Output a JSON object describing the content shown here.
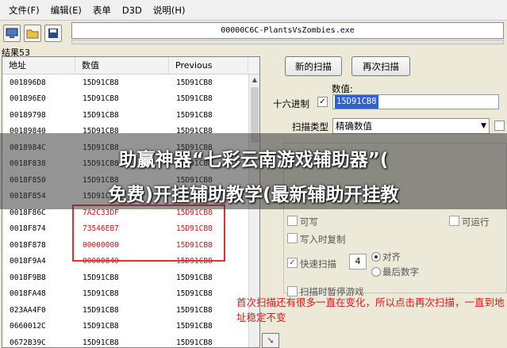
{
  "menu": [
    "文件(F)",
    "编辑(E)",
    "表单",
    "D3D",
    "说明(H)"
  ],
  "process": "00000C6C-PlantsVsZombies.exe",
  "result_count": "结果53",
  "list": {
    "headers": [
      "地址",
      "数值",
      "Previous"
    ],
    "rows": [
      {
        "addr": "001896D8",
        "val": "15D91CB8",
        "prev": "15D91CB8"
      },
      {
        "addr": "001896E0",
        "val": "15D91CB8",
        "prev": "15D91CB8"
      },
      {
        "addr": "00189798",
        "val": "15D91CB8",
        "prev": "15D91CB8"
      },
      {
        "addr": "00189840",
        "val": "15D91CB8",
        "prev": "15D91CB8"
      },
      {
        "addr": "0018984C",
        "val": "15D91CB8",
        "prev": "15D91CB8"
      },
      {
        "addr": "0018F838",
        "val": "15D91CB8",
        "prev": "15D91CB8"
      },
      {
        "addr": "0018F850",
        "val": "15D91CB8",
        "prev": "15D91CB8"
      },
      {
        "addr": "0018F854",
        "val": "15D91CB8",
        "prev": "15D91CB8"
      },
      {
        "addr": "0018F86C",
        "val": "7A2C33DF",
        "prev": "15D91CB8"
      },
      {
        "addr": "0018F874",
        "val": "73546EB7",
        "prev": "15D91CB8"
      },
      {
        "addr": "0018F878",
        "val": "00000000",
        "prev": "15D91CB8"
      },
      {
        "addr": "0018F9A4",
        "val": "00000840",
        "prev": "15D91CB8"
      },
      {
        "addr": "0018F9B8",
        "val": "15D91CB8",
        "prev": "15D91CB8"
      },
      {
        "addr": "0018FA48",
        "val": "15D91CB8",
        "prev": "15D91CB8"
      },
      {
        "addr": "023AA4F0",
        "val": "15D91CB8",
        "prev": "15D91CB8"
      },
      {
        "addr": "0660012C",
        "val": "15D91CB8",
        "prev": "15D91CB8"
      },
      {
        "addr": "0672B39C",
        "val": "15D91CB8",
        "prev": "15D91CB8"
      }
    ]
  },
  "buttons": {
    "first_scan": "新的扫描",
    "next_scan": "再次扫描"
  },
  "value_label": "数值:",
  "hex_label": "十六进制",
  "hex_checked": "✓",
  "value_input": "15D91CB8",
  "scan_type_label": "扫描类型",
  "scan_type_value": "精确数值",
  "options": {
    "writable": "可写",
    "executable": "可运行",
    "copy_on_write": "写入时复制",
    "fast_scan": "快速扫描",
    "fast_scan_checked": "✓",
    "fast_scan_value": "4",
    "align": "对齐",
    "last_digits": "最后数字",
    "pause_scan": "扫描时暂停游戏"
  },
  "annotation": "首次扫描还有很多一直在变化，所以点击再次扫描，一直到地址稳定不变",
  "banner": {
    "line1": "助赢神器“七彩云南游戏辅助器”(",
    "line2": "免费)开挂辅助教学(最新辅助开挂教"
  },
  "colors": {
    "highlight": "#e03030",
    "annotation": "#d61a1a",
    "selection": "#3060c8"
  }
}
